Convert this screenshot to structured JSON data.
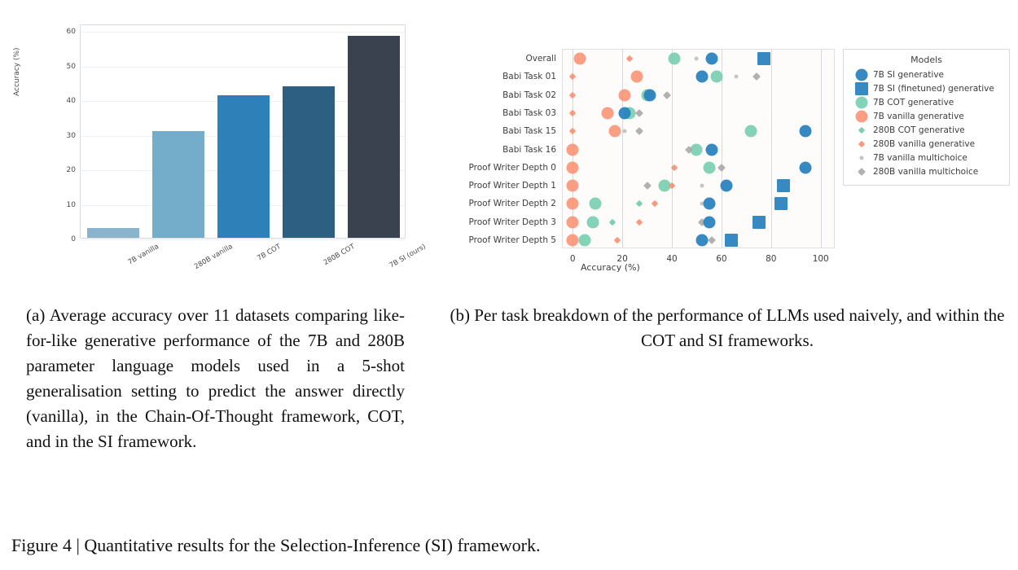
{
  "figure": {
    "caption": "Figure 4 | Quantitative results for the Selection-Inference (SI) framework.",
    "subcaption_a": "(a)   Average accuracy over 11 datasets comparing like-for-like generative performance of the 7B and 280B parameter language models used in a 5-shot generalisation setting to predict the answer directly (vanilla), in the Chain-Of-Thought framework, COT, and in the SI framework.",
    "subcaption_b": "(b)  Per task breakdown of the performance of LLMs used naively, and within the COT and SI frameworks."
  },
  "chart_data": [
    {
      "type": "bar",
      "title": "",
      "xlabel": "",
      "ylabel": "Accuracy (%)",
      "categories": [
        "7B vanilla",
        "280B vanilla",
        "7B COT",
        "280B COT",
        "7B SI (ours)"
      ],
      "values": [
        2.8,
        31.0,
        41.2,
        43.8,
        58.5
      ],
      "colors": [
        "#8ab4cd",
        "#74adc9",
        "#2e80b8",
        "#2d5f82",
        "#39424e"
      ],
      "ylim": [
        0,
        62
      ],
      "yticks": [
        0,
        10,
        20,
        30,
        40,
        50,
        60
      ],
      "grid": true
    },
    {
      "type": "scatter",
      "title": "",
      "xlabel": "Accuracy (%)",
      "ylabel": "",
      "xlim": [
        -4,
        106
      ],
      "xticks": [
        0,
        20,
        40,
        60,
        80,
        100
      ],
      "grid": true,
      "legend_position": "right",
      "legend_title": "Models",
      "series": [
        {
          "name": "7B SI generative",
          "marker": "circle",
          "size": 15,
          "color": "#2b83be",
          "opacity": 0.95,
          "points": [
            {
              "category": "Overall",
              "value": 56
            },
            {
              "category": "Babi Task 01",
              "value": 52
            },
            {
              "category": "Babi Task 02",
              "value": 31
            },
            {
              "category": "Babi Task 03",
              "value": 21
            },
            {
              "category": "Babi Task 15",
              "value": 94
            },
            {
              "category": "Babi Task 16",
              "value": 56
            },
            {
              "category": "Proof Writer Depth 0",
              "value": 94
            },
            {
              "category": "Proof Writer Depth 1",
              "value": 62
            },
            {
              "category": "Proof Writer Depth 2",
              "value": 55
            },
            {
              "category": "Proof Writer Depth 3",
              "value": 55
            },
            {
              "category": "Proof Writer Depth 5",
              "value": 52
            }
          ]
        },
        {
          "name": "7B SI (finetuned) generative",
          "marker": "square",
          "size": 16,
          "color": "#2b83be",
          "opacity": 0.95,
          "points": [
            {
              "category": "Overall",
              "value": 77
            },
            {
              "category": "Proof Writer Depth 1",
              "value": 85
            },
            {
              "category": "Proof Writer Depth 2",
              "value": 84
            },
            {
              "category": "Proof Writer Depth 3",
              "value": 75
            },
            {
              "category": "Proof Writer Depth 5",
              "value": 64
            }
          ]
        },
        {
          "name": "7B COT generative",
          "marker": "circle",
          "size": 15,
          "color": "#6ecaab",
          "opacity": 0.85,
          "points": [
            {
              "category": "Overall",
              "value": 41
            },
            {
              "category": "Babi Task 01",
              "value": 58
            },
            {
              "category": "Babi Task 02",
              "value": 30
            },
            {
              "category": "Babi Task 03",
              "value": 23
            },
            {
              "category": "Babi Task 15",
              "value": 72
            },
            {
              "category": "Babi Task 16",
              "value": 50
            },
            {
              "category": "Proof Writer Depth 0",
              "value": 55
            },
            {
              "category": "Proof Writer Depth 1",
              "value": 37
            },
            {
              "category": "Proof Writer Depth 2",
              "value": 9
            },
            {
              "category": "Proof Writer Depth 3",
              "value": 8
            },
            {
              "category": "Proof Writer Depth 5",
              "value": 5
            }
          ]
        },
        {
          "name": "7B vanilla generative",
          "marker": "circle",
          "size": 15,
          "color": "#f98e6f",
          "opacity": 0.85,
          "points": [
            {
              "category": "Overall",
              "value": 3
            },
            {
              "category": "Babi Task 01",
              "value": 26
            },
            {
              "category": "Babi Task 02",
              "value": 21
            },
            {
              "category": "Babi Task 03",
              "value": 14
            },
            {
              "category": "Babi Task 15",
              "value": 17
            },
            {
              "category": "Babi Task 16",
              "value": 0
            },
            {
              "category": "Proof Writer Depth 0",
              "value": 0
            },
            {
              "category": "Proof Writer Depth 1",
              "value": 0
            },
            {
              "category": "Proof Writer Depth 2",
              "value": 0
            },
            {
              "category": "Proof Writer Depth 3",
              "value": 0
            },
            {
              "category": "Proof Writer Depth 5",
              "value": 0
            }
          ]
        },
        {
          "name": "280B COT generative",
          "marker": "diamond",
          "size": 6,
          "color": "#6ecaab",
          "opacity": 0.9,
          "points": [
            {
              "category": "Proof Writer Depth 2",
              "value": 27
            },
            {
              "category": "Proof Writer Depth 3",
              "value": 16
            }
          ]
        },
        {
          "name": "280B vanilla generative",
          "marker": "diamond",
          "size": 6,
          "color": "#f98e6f",
          "opacity": 0.9,
          "points": [
            {
              "category": "Overall",
              "value": 23
            },
            {
              "category": "Babi Task 01",
              "value": 0
            },
            {
              "category": "Babi Task 02",
              "value": 0
            },
            {
              "category": "Babi Task 03",
              "value": 0
            },
            {
              "category": "Babi Task 15",
              "value": 0
            },
            {
              "category": "Proof Writer Depth 0",
              "value": 41
            },
            {
              "category": "Proof Writer Depth 1",
              "value": 40
            },
            {
              "category": "Proof Writer Depth 2",
              "value": 33
            },
            {
              "category": "Proof Writer Depth 3",
              "value": 27
            },
            {
              "category": "Proof Writer Depth 5",
              "value": 18
            }
          ]
        },
        {
          "name": "7B vanilla multichoice",
          "marker": "circle",
          "size": 5,
          "color": "#bfbfbf",
          "opacity": 0.9,
          "points": [
            {
              "category": "Overall",
              "value": 50
            },
            {
              "category": "Babi Task 01",
              "value": 66
            },
            {
              "category": "Babi Task 15",
              "value": 21
            },
            {
              "category": "Proof Writer Depth 1",
              "value": 52
            },
            {
              "category": "Proof Writer Depth 2",
              "value": 52
            }
          ]
        },
        {
          "name": "280B vanilla multichoice",
          "marker": "diamond",
          "size": 7,
          "color": "#a8a8a8",
          "opacity": 0.9,
          "points": [
            {
              "category": "Babi Task 01",
              "value": 74
            },
            {
              "category": "Babi Task 02",
              "value": 38
            },
            {
              "category": "Babi Task 03",
              "value": 27
            },
            {
              "category": "Babi Task 15",
              "value": 27
            },
            {
              "category": "Babi Task 16",
              "value": 47
            },
            {
              "category": "Proof Writer Depth 0",
              "value": 60
            },
            {
              "category": "Proof Writer Depth 1",
              "value": 30
            },
            {
              "category": "Proof Writer Depth 3",
              "value": 52
            },
            {
              "category": "Proof Writer Depth 5",
              "value": 56
            }
          ]
        }
      ],
      "categories": [
        "Overall",
        "Babi Task 01",
        "Babi Task 02",
        "Babi Task 03",
        "Babi Task 15",
        "Babi Task 16",
        "Proof Writer Depth 0",
        "Proof Writer Depth 1",
        "Proof Writer Depth 2",
        "Proof Writer Depth 3",
        "Proof Writer Depth 5"
      ]
    }
  ]
}
